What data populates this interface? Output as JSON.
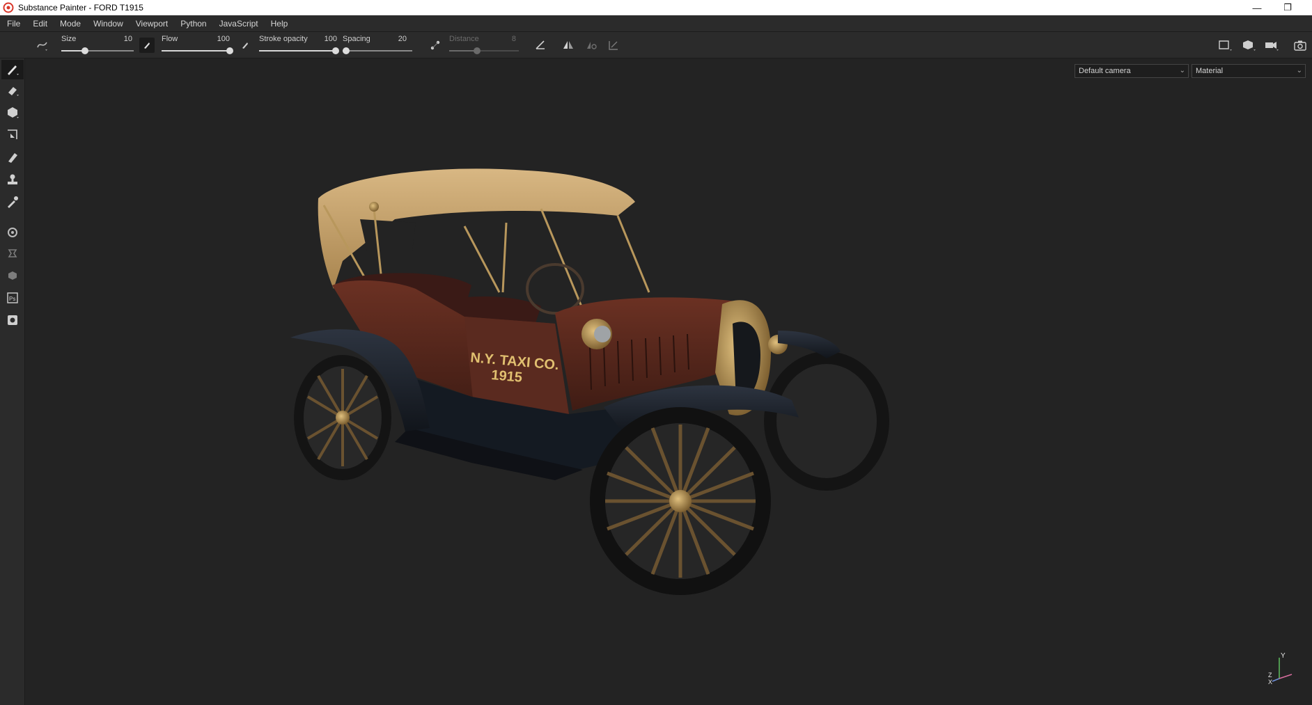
{
  "window": {
    "title": "Substance Painter - FORD T1915",
    "minimize_glyph": "—",
    "restore_glyph": "❐"
  },
  "menu": [
    "File",
    "Edit",
    "Mode",
    "Window",
    "Viewport",
    "Python",
    "JavaScript",
    "Help"
  ],
  "toolbar": {
    "size": {
      "label": "Size",
      "value": "10",
      "fraction": 0.33
    },
    "flow": {
      "label": "Flow",
      "value": "100",
      "fraction": 1.0
    },
    "stroke_opacity": {
      "label": "Stroke opacity",
      "value": "100",
      "fraction": 1.0
    },
    "spacing": {
      "label": "Spacing",
      "value": "20",
      "fraction": 0.05
    },
    "distance": {
      "label": "Distance",
      "value": "8",
      "fraction": 0.4
    }
  },
  "viewport": {
    "camera_select": "Default camera",
    "mode_select": "Material",
    "decal_line1": "N.Y. TAXI CO.",
    "decal_line2": "1915",
    "axis_y": "Y",
    "axis_z": "Z",
    "axis_x": "X"
  },
  "tools": [
    "paint-brush-icon",
    "eraser-icon",
    "projection-icon",
    "polygon-fill-icon",
    "smudge-icon",
    "clone-stamp-icon",
    "color-picker-icon",
    "bake-settings-icon",
    "layer-stack-icon",
    "texture-set-icon",
    "photoshop-export-icon",
    "export-textures-icon"
  ],
  "colors": {
    "panel": "#2b2b2b",
    "viewport_bg": "#232323",
    "body_maroon": "#5a2a1f",
    "roof_tan": "#c9a574",
    "brass": "#b08a4a"
  }
}
